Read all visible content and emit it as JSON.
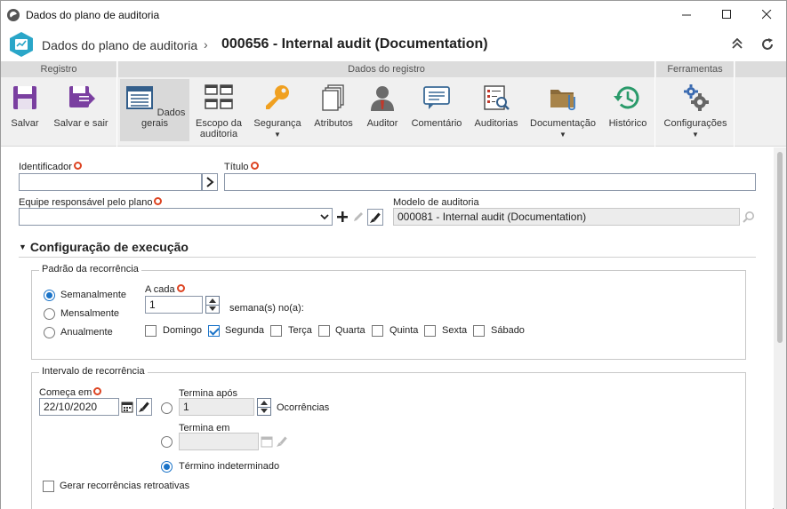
{
  "window": {
    "title": "Dados do plano de auditoria"
  },
  "header": {
    "breadcrumb_parent": "Dados do plano de auditoria",
    "breadcrumb_separator": "›",
    "record_title": "000656 - Internal audit (Documentation)"
  },
  "ribbon": {
    "groups": {
      "registro": "Registro",
      "dados_registro": "Dados do registro",
      "ferramentas": "Ferramentas"
    },
    "buttons": {
      "salvar": "Salvar",
      "salvar_sair": "Salvar e sair",
      "dados_gerais": "Dados gerais",
      "escopo_1": "Escopo da",
      "escopo_2": "auditoria",
      "seguranca": "Segurança",
      "atributos": "Atributos",
      "auditor": "Auditor",
      "comentario": "Comentário",
      "auditorias": "Auditorias",
      "documentacao": "Documentação",
      "historico": "Histórico",
      "configuracoes": "Configurações"
    }
  },
  "form": {
    "identificador": {
      "label": "Identificador",
      "value": ""
    },
    "titulo": {
      "label": "Título",
      "value": ""
    },
    "equipe": {
      "label": "Equipe responsável pelo plano",
      "value": ""
    },
    "modelo": {
      "label": "Modelo de auditoria",
      "value": "000081 - Internal audit (Documentation)"
    }
  },
  "execucao": {
    "section_title": "Configuração de execução",
    "padrao": {
      "legend": "Padrão da recorrência",
      "options": [
        "Semanalmente",
        "Mensalmente",
        "Anualmente"
      ],
      "selected": "Semanalmente",
      "a_cada_label": "A cada",
      "a_cada_value": "1",
      "semanas_label": "semana(s) no(a):",
      "days": [
        {
          "label": "Domingo",
          "checked": false
        },
        {
          "label": "Segunda",
          "checked": true
        },
        {
          "label": "Terça",
          "checked": false
        },
        {
          "label": "Quarta",
          "checked": false
        },
        {
          "label": "Quinta",
          "checked": false
        },
        {
          "label": "Sexta",
          "checked": false
        },
        {
          "label": "Sábado",
          "checked": false
        }
      ]
    },
    "intervalo": {
      "legend": "Intervalo de recorrência",
      "comeca_label": "Começa em",
      "comeca_value": "22/10/2020",
      "termina_apos_label": "Termina após",
      "termina_apos_value": "1",
      "ocorrencias_label": "Ocorrências",
      "termina_em_label": "Termina em",
      "termina_em_value": "",
      "indeterminado_label": "Término indeterminado",
      "selected": "Término indeterminado",
      "retroativas_label": "Gerar recorrências retroativas",
      "retroativas_checked": false
    }
  },
  "colors": {
    "accent": "#1a73c8",
    "required": "#dd4422",
    "ribbon_bg": "#f0f0f0",
    "group_head": "#dcdcdc"
  }
}
